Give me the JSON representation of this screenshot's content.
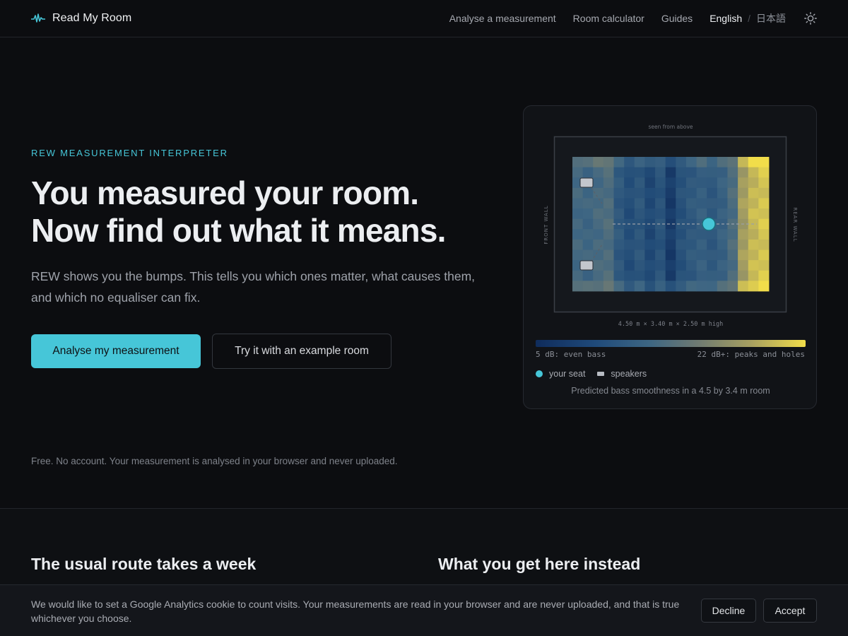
{
  "brand": {
    "name": "Read My Room",
    "icon": "waveform-icon"
  },
  "nav": {
    "links": [
      "Analyse a measurement",
      "Room calculator",
      "Guides"
    ],
    "language_active": "English",
    "language_separator": "/",
    "language_other": "日本語",
    "theme_icon": "sun-icon"
  },
  "hero": {
    "eyebrow": "REW MEASUREMENT INTERPRETER",
    "headline_line1": "You measured your room.",
    "headline_line2": "Now find out what it means.",
    "lede": "REW shows you the bumps. This tells you which ones matter, what causes them, and which no equaliser can fix.",
    "primary_button": "Analyse my measurement",
    "secondary_button": "Try it with an example room",
    "fineprint": "Free. No account. Your measurement is analysed in your browser and never uploaded."
  },
  "room_card": {
    "view_label": "seen from above",
    "front_wall_label": "FRONT WALL",
    "rear_wall_label": "REAR WALL",
    "dimensions": "4.50 m × 3.40 m × 2.50 m high",
    "scale_low_label": "5 dB: even bass",
    "scale_high_label": "22 dB+: peaks and holes",
    "legend_seat": "your seat",
    "legend_speakers": "speakers",
    "caption": "Predicted bass smoothness in a 4.5 by 3.4 m room",
    "colors": {
      "seat": "#46c6d8",
      "smooth": "#0f2c5c",
      "rough": "#f1dd4a"
    }
  },
  "sections": {
    "left_title": "The usual route takes a week",
    "right_title": "What you get here instead"
  },
  "cookie": {
    "text": "We would like to set a Google Analytics cookie to count visits. Your measurements are read in your browser and are never uploaded, and that is true whichever you choose.",
    "decline": "Decline",
    "accept": "Accept"
  }
}
